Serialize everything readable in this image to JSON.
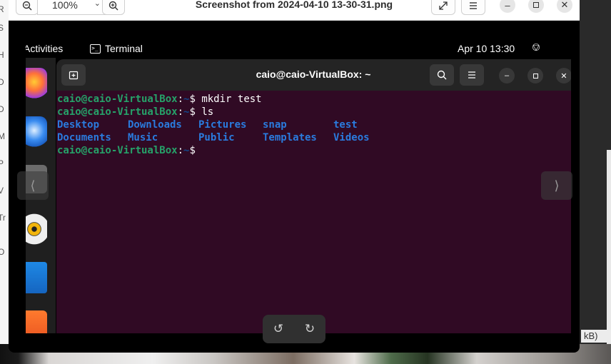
{
  "background": {
    "left_items": [
      "R",
      "S",
      "H",
      "D",
      "D",
      "M",
      "P",
      "V",
      "Tr",
      "O"
    ],
    "size_suffix": "kB)"
  },
  "viewer": {
    "zoom": "100%",
    "title": "Screenshot from 2024-04-10 13-30-31.png",
    "icons": [
      "zoom-out-icon",
      "chevron-down-icon",
      "zoom-in-icon",
      "fullscreen-icon",
      "hamburger-menu-icon",
      "minimize-icon",
      "maximize-icon",
      "close-icon"
    ],
    "rotate_icons": [
      "rotate-left-icon",
      "rotate-right-icon"
    ],
    "nav_icons": [
      "previous-image-icon",
      "next-image-icon"
    ]
  },
  "desktop": {
    "activities": "Activities",
    "app_name": "Terminal",
    "clock": "Apr 10  13:30",
    "dock_apps": [
      "firefox-icon",
      "thunderbird-icon",
      "files-icon",
      "rhythmbox-icon",
      "libreoffice-writer-icon",
      "app-center-icon"
    ]
  },
  "terminal": {
    "title": "caio@caio-VirtualBox: ~",
    "user_host": "caio@caio-VirtualBox",
    "path": "~",
    "commands": [
      "mkdir test",
      "ls"
    ],
    "ls_row1": [
      "Desktop",
      "Downloads",
      "Pictures",
      "snap",
      "test"
    ],
    "ls_row2": [
      "Documents",
      "Music",
      "Public",
      "Templates",
      "Videos"
    ]
  },
  "colors": {
    "terminal_bg": "#300a24",
    "prompt_green": "#26a269",
    "dir_blue": "#2a7bde",
    "path_blue": "#12488b"
  }
}
